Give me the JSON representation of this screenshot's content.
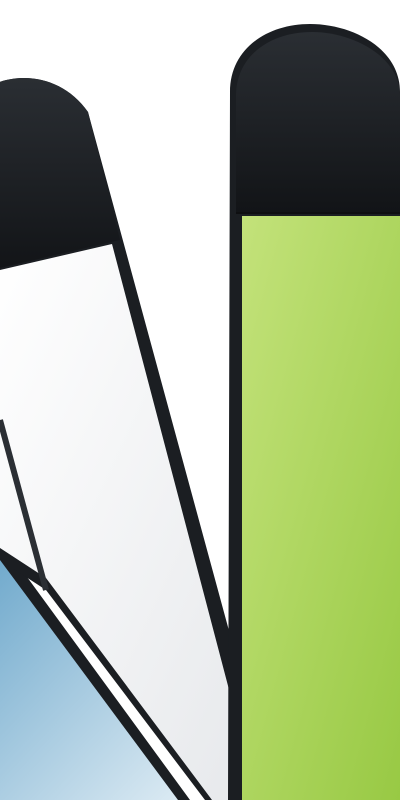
{
  "scene": {
    "background_color": "#ffffff",
    "bezel_color": "#1b1e22",
    "bezel_highlight_color": "#3a3f46",
    "panels": [
      {
        "id": "green-panel",
        "screen_color_top": "#b8dc6c",
        "screen_color_bottom": "#9ccc46",
        "cap_color": "#14161a"
      },
      {
        "id": "white-panel",
        "screen_color_top": "#ffffff",
        "screen_color_bottom": "#e9ebee",
        "cap_color": "#14161a"
      },
      {
        "id": "blue-panel",
        "screen_color_top": "#6aa9cc",
        "screen_color_bottom": "#d7e8f2",
        "cap_color": "#14161a"
      }
    ]
  }
}
